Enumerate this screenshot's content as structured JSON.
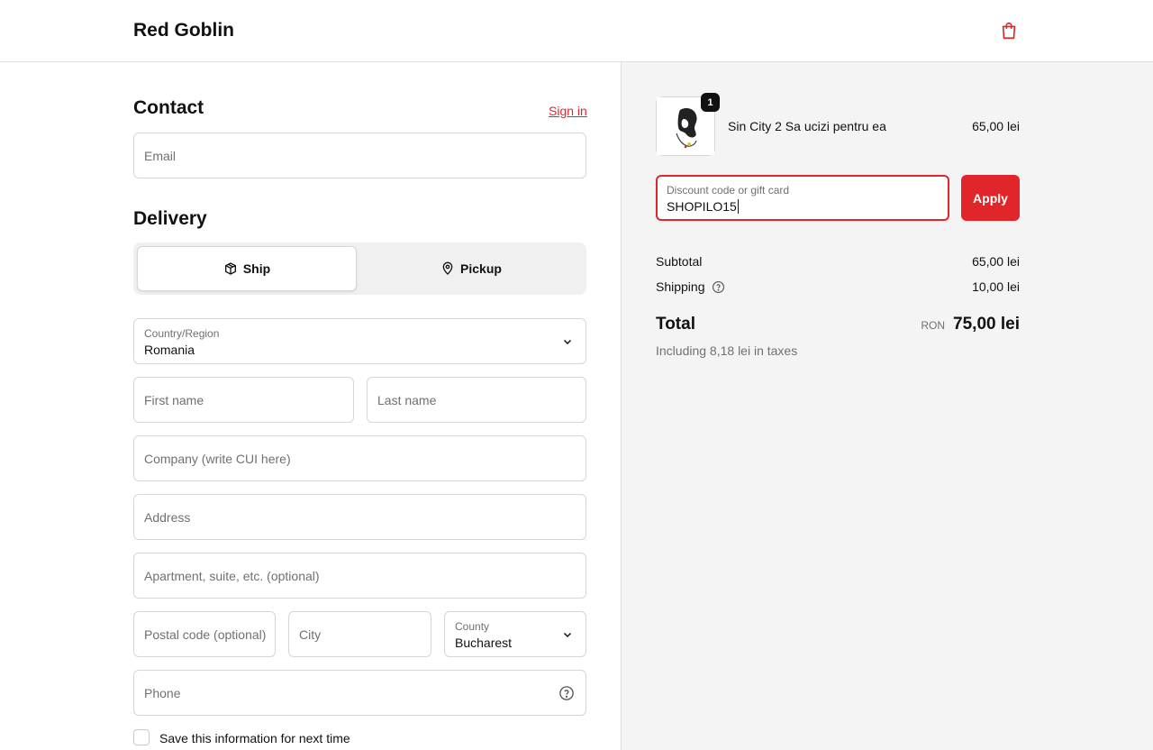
{
  "header": {
    "brand": "Red Goblin",
    "cart_icon": "shopping-bag-icon"
  },
  "contact": {
    "title": "Contact",
    "signin_link": "Sign in",
    "email_placeholder": "Email"
  },
  "delivery": {
    "title": "Delivery",
    "options": [
      {
        "label": "Ship",
        "icon": "package-icon",
        "selected": true
      },
      {
        "label": "Pickup",
        "icon": "map-pin-icon",
        "selected": false
      }
    ],
    "country_label": "Country/Region",
    "country_value": "Romania",
    "first_name_placeholder": "First name",
    "last_name_placeholder": "Last name",
    "company_placeholder": "Company (write CUI here)",
    "address_placeholder": "Address",
    "apartment_placeholder": "Apartment, suite, etc. (optional)",
    "postal_placeholder": "Postal code (optional)",
    "city_placeholder": "City",
    "county_label": "County",
    "county_value": "Bucharest",
    "phone_placeholder": "Phone",
    "save_info_label": "Save this information for next time"
  },
  "summary": {
    "item": {
      "quantity": "1",
      "name": "Sin City 2 Sa ucizi pentru ea",
      "price": "65,00 lei"
    },
    "discount_label": "Discount code or gift card",
    "discount_value": "SHOPILO15",
    "apply_label": "Apply",
    "subtotal_label": "Subtotal",
    "subtotal_value": "65,00 lei",
    "shipping_label": "Shipping",
    "shipping_value": "10,00 lei",
    "total_label": "Total",
    "currency": "RON",
    "total_value": "75,00 lei",
    "taxes_note": "Including 8,18 lei in taxes"
  },
  "colors": {
    "accent": "#e0262b",
    "panel_bg": "#f4f4f4",
    "border": "#d6d6d6"
  }
}
